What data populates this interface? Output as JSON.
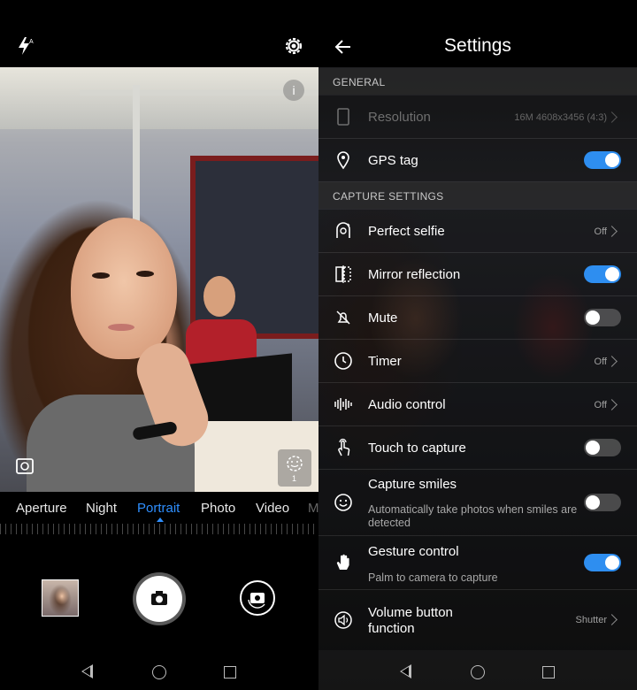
{
  "camera": {
    "modes": [
      "Aperture",
      "Night",
      "Portrait",
      "Photo",
      "Video",
      "M"
    ],
    "active_mode": "Portrait",
    "info_glyph": "i",
    "smile_count": "1",
    "icons": [
      "flash-auto-icon",
      "gear-icon",
      "info-icon",
      "frame-icon",
      "smile-detect-icon",
      "gallery-thumbnail",
      "shutter-camera-icon",
      "switch-camera-icon"
    ]
  },
  "settings": {
    "title": "Settings",
    "sections": {
      "general": "GENERAL",
      "capture": "CAPTURE SETTINGS"
    },
    "items": [
      {
        "label": "Resolution",
        "value": "16M 4608x3456 (4:3)",
        "disabled": true,
        "icon": "resolution-icon"
      },
      {
        "label": "GPS tag",
        "toggle": "on",
        "icon": "location-pin-icon"
      },
      {
        "label": "Perfect selfie",
        "value": "Off",
        "icon": "perfect-selfie-icon"
      },
      {
        "label": "Mirror reflection",
        "toggle": "on",
        "icon": "mirror-icon"
      },
      {
        "label": "Mute",
        "toggle": "off",
        "icon": "mute-icon"
      },
      {
        "label": "Timer",
        "value": "Off",
        "icon": "clock-icon"
      },
      {
        "label": "Audio control",
        "value": "Off",
        "icon": "audio-wave-icon"
      },
      {
        "label": "Touch to capture",
        "toggle": "off",
        "icon": "touch-icon"
      },
      {
        "label": "Capture smiles",
        "sub": "Automatically take photos when smiles are detected",
        "toggle": "off",
        "icon": "smile-icon"
      },
      {
        "label": "Gesture control",
        "sub": "Palm to camera to capture",
        "toggle": "on",
        "icon": "palm-icon"
      },
      {
        "label": "Volume button function",
        "value": "Shutter",
        "icon": "volume-icon"
      }
    ]
  },
  "colors": {
    "accent": "#2e8ef0",
    "mode_active": "#2f8fff"
  }
}
